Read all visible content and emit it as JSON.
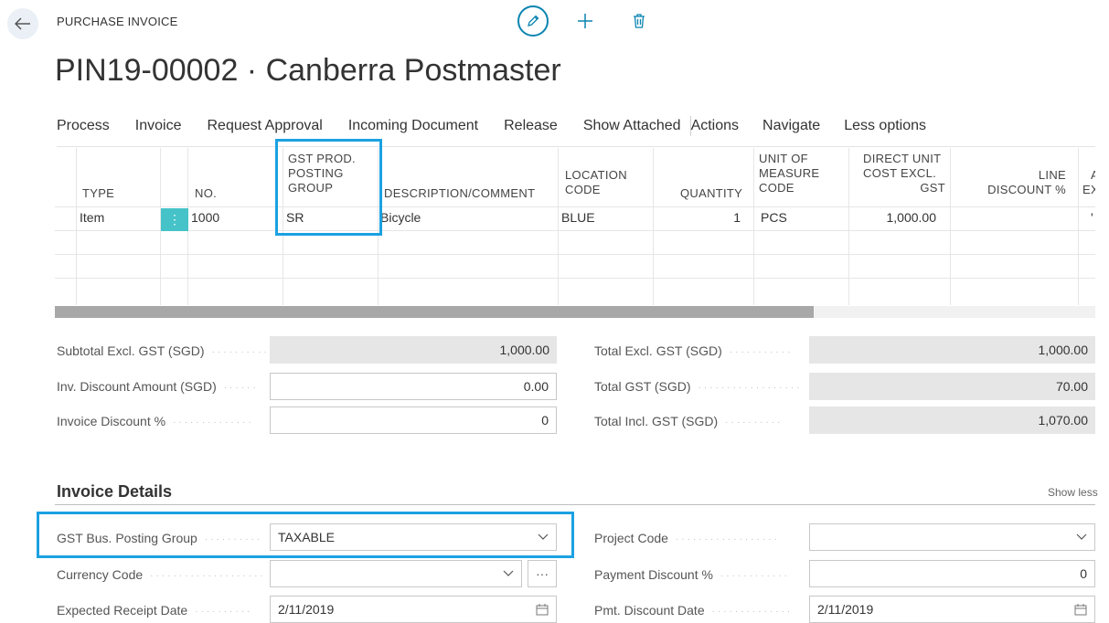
{
  "header": {
    "breadcrumb": "PURCHASE INVOICE",
    "title": "PIN19-00002 · Canberra Postmaster",
    "accent": "#1ba1e2"
  },
  "actions": [
    "Process",
    "Invoice",
    "Request Approval",
    "Incoming Document",
    "Release",
    "Show Attached",
    "Actions",
    "Navigate",
    "Less options"
  ],
  "lines": {
    "headers": {
      "type": "TYPE",
      "no": "NO.",
      "gst_l1": "GST PROD.",
      "gst_l2": "POSTING",
      "gst_l3": "GROUP",
      "desc": "DESCRIPTION/COMMENT",
      "loc_l1": "LOCATION",
      "loc_l2": "CODE",
      "qty": "QUANTITY",
      "uom_l1": "UNIT OF",
      "uom_l2": "MEASURE",
      "uom_l3": "CODE",
      "cost_l1": "DIRECT UNIT",
      "cost_l2": "COST EXCL.",
      "cost_l3": "GST",
      "disc_l1": "LINE",
      "disc_l2": "DISCOUNT %",
      "amt_l1": "A",
      "amt_l2": "EX"
    },
    "row1": {
      "type": "Item",
      "no": "1000",
      "gst": "SR",
      "desc": "Bicycle",
      "loc": "BLUE",
      "qty": "1",
      "uom": "PCS",
      "cost": "1,000.00"
    }
  },
  "totals": {
    "subtotal_label": "Subtotal Excl. GST (SGD)",
    "subtotal": "1,000.00",
    "inv_disc_amt_label": "Inv. Discount Amount (SGD)",
    "inv_disc_amt": "0.00",
    "inv_disc_pct_label": "Invoice Discount %",
    "inv_disc_pct": "0",
    "total_excl_label": "Total Excl. GST (SGD)",
    "total_excl": "1,000.00",
    "total_gst_label": "Total GST (SGD)",
    "total_gst": "70.00",
    "total_incl_label": "Total Incl. GST (SGD)",
    "total_incl": "1,070.00"
  },
  "details": {
    "title": "Invoice Details",
    "show_less": "Show less",
    "gst_bus_label": "GST Bus. Posting Group",
    "gst_bus": "TAXABLE",
    "currency_label": "Currency Code",
    "currency": "",
    "expected_label": "Expected Receipt Date",
    "expected": "2/11/2019",
    "project_label": "Project Code",
    "project": "",
    "pay_disc_label": "Payment Discount %",
    "pay_disc": "0",
    "pmt_date_label": "Pmt. Discount Date",
    "pmt_date": "2/11/2019"
  }
}
